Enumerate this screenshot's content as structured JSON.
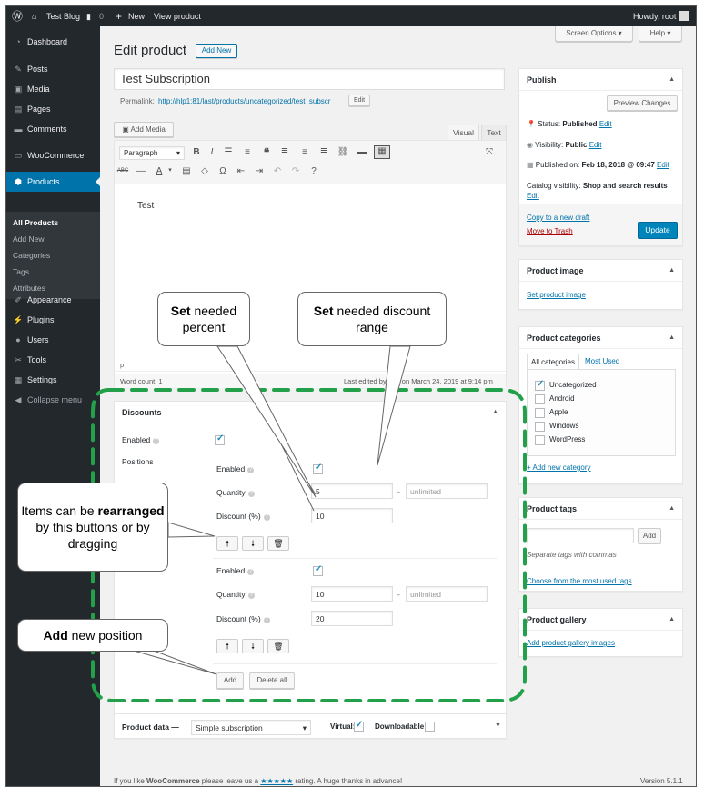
{
  "adminbar": {
    "site_name": "Test Blog",
    "comments_count": "0",
    "new_label": "New",
    "view_product": "View product",
    "howdy": "Howdy, root"
  },
  "sidebar": {
    "items": [
      {
        "label": "Dashboard",
        "icon": "dashboard-icon"
      },
      {
        "label": "Posts",
        "icon": "pin-icon"
      },
      {
        "label": "Media",
        "icon": "media-icon"
      },
      {
        "label": "Pages",
        "icon": "page-icon"
      },
      {
        "label": "Comments",
        "icon": "comment-icon"
      },
      {
        "label": "WooCommerce",
        "icon": "woo-icon"
      },
      {
        "label": "Products",
        "icon": "box-icon"
      },
      {
        "label": "Appearance",
        "icon": "brush-icon"
      },
      {
        "label": "Plugins",
        "icon": "plug-icon"
      },
      {
        "label": "Users",
        "icon": "user-icon"
      },
      {
        "label": "Tools",
        "icon": "wrench-icon"
      },
      {
        "label": "Settings",
        "icon": "settings-icon"
      },
      {
        "label": "Collapse menu",
        "icon": "collapse-icon"
      }
    ],
    "submenu": [
      "All Products",
      "Add New",
      "Categories",
      "Tags",
      "Attributes"
    ]
  },
  "header": {
    "screen_options": "Screen Options",
    "help": "Help",
    "title": "Edit product",
    "add_new": "Add New"
  },
  "post": {
    "title": "Test Subscription",
    "permalink_label": "Permalink:",
    "permalink_url": "http://hlp1:81/last/products/uncategorized/test_subscr",
    "edit": "Edit",
    "add_media": "Add Media",
    "tab_visual": "Visual",
    "tab_text": "Text",
    "format": "Paragraph",
    "body": "Test",
    "path": "p",
    "word_count": "Word count: 1",
    "last_edited": "Last edited by root on March 24, 2019 at 9:14 pm"
  },
  "discounts": {
    "title": "Discounts",
    "enabled_label": "Enabled",
    "positions_label": "Positions",
    "pos_enabled_label": "Enabled",
    "quantity_label": "Quantity",
    "discount_label": "Discount (%)",
    "positions": [
      {
        "from": "5",
        "to_placeholder": "unlimited",
        "discount": "10"
      },
      {
        "from": "10",
        "to_placeholder": "unlimited",
        "discount": "20"
      }
    ],
    "up": "🠕",
    "down": "🠗",
    "delete": "🗑",
    "add": "Add",
    "delete_all": "Delete all"
  },
  "product_data": {
    "label": "Product data —",
    "type": "Simple subscription",
    "virtual": "Virtual:",
    "downloadable": "Downloadable:"
  },
  "footer": {
    "thanks_prefix": "If you like ",
    "woo": "WooCommerce",
    "thanks_mid": " please leave us a ",
    "stars": "★★★★★",
    "thanks_suffix": " rating. A huge thanks in advance!",
    "version": "Version 5.1.1"
  },
  "publish": {
    "title": "Publish",
    "preview": "Preview Changes",
    "status_label": "Status:",
    "status": "Published",
    "visibility_label": "Visibility:",
    "visibility": "Public",
    "published_label": "Published on:",
    "published": "Feb 18, 2018 @ 09:47",
    "catalog_label": "Catalog visibility:",
    "catalog": "Shop and search results",
    "edit": "Edit",
    "copy": "Copy to a new draft",
    "trash": "Move to Trash",
    "update": "Update"
  },
  "product_image": {
    "title": "Product image",
    "link": "Set product image"
  },
  "categories": {
    "title": "Product categories",
    "tab_all": "All categories",
    "tab_used": "Most Used",
    "items": [
      {
        "label": "Uncategorized",
        "checked": true
      },
      {
        "label": "Android",
        "checked": false
      },
      {
        "label": "Apple",
        "checked": false
      },
      {
        "label": "Windows",
        "checked": false
      },
      {
        "label": "WordPress",
        "checked": false
      }
    ],
    "add": "+ Add new category"
  },
  "tags": {
    "title": "Product tags",
    "add": "Add",
    "hint": "Separate tags with commas",
    "choose": "Choose from the most used tags"
  },
  "gallery": {
    "title": "Product gallery",
    "link": "Add product gallery images"
  },
  "callouts": {
    "percent_bold": "Set",
    "percent_rest": " needed percent",
    "range_bold": "Set",
    "range_rest": " needed discount range",
    "rearr_pre": "Items can be ",
    "rearr_bold": "rearranged",
    "rearr_post": " by this buttons or by dragging",
    "add_bold": "Add",
    "add_rest": " new position"
  },
  "colors": {
    "accent": "#0073aa",
    "highlight": "#22a14a",
    "sidebar": "#23282d"
  }
}
